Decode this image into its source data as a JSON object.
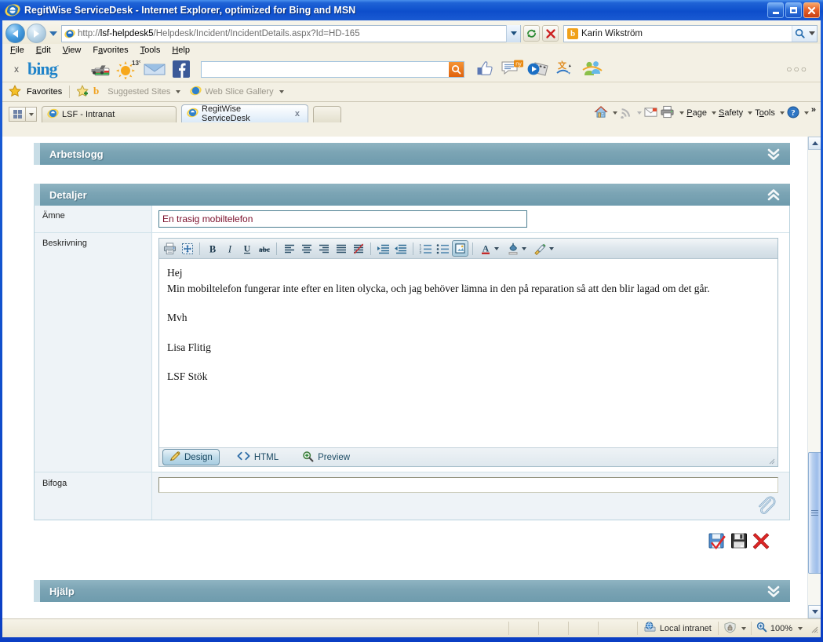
{
  "window": {
    "title": "RegitWise ServiceDesk - Internet Explorer, optimized for Bing and MSN",
    "minimize_label": "Minimize",
    "maximize_label": "Maximize",
    "close_label": "Close"
  },
  "address": {
    "back_label": "Back",
    "forward_label": "Forward",
    "recent_label": "Recent pages",
    "url_host": "lsf-helpdesk5",
    "url_prefix": "http://",
    "url_path": "/Helpdesk/Incident/IncidentDetails.aspx?Id=HD-165",
    "url_full": "http://lsf-helpdesk5/Helpdesk/Incident/IncidentDetails.aspx?Id=HD-165",
    "refresh_label": "Refresh",
    "stop_label": "Stop",
    "search_value": "Karin Wikström",
    "search_placeholder": "Search",
    "search_provider": "b"
  },
  "menu": {
    "items": [
      {
        "pre": "",
        "mnem": "F",
        "post": "ile"
      },
      {
        "pre": "",
        "mnem": "E",
        "post": "dit"
      },
      {
        "pre": "",
        "mnem": "V",
        "post": "iew"
      },
      {
        "pre": "F",
        "mnem": "a",
        "post": "vorites"
      },
      {
        "pre": "",
        "mnem": "T",
        "post": "ools"
      },
      {
        "pre": "",
        "mnem": "H",
        "post": "elp"
      }
    ]
  },
  "bingbar": {
    "close_label": "x",
    "logo": "bing",
    "logo_mark": "·",
    "weather_temp": "13°",
    "icons": [
      {
        "name": "car-deals-icon"
      },
      {
        "name": "weather-icon"
      },
      {
        "name": "mail-icon"
      },
      {
        "name": "facebook-icon"
      }
    ],
    "search_placeholder": "",
    "search_value": "",
    "right_icons": [
      {
        "name": "facebook-like-icon"
      },
      {
        "name": "messages-icon",
        "badge": "ny"
      },
      {
        "name": "video-icon"
      },
      {
        "name": "translate-icon"
      },
      {
        "name": "messenger-icon"
      }
    ],
    "overflow": "○○○"
  },
  "favbar": {
    "favorites_label": "Favorites",
    "add_label": "Add to Favorites",
    "suggested_sites": "Suggested Sites",
    "web_slice_gallery": "Web Slice Gallery"
  },
  "tabs": {
    "quicktabs_label": "Quick Tabs",
    "tablist_label": "Tab List",
    "items": [
      {
        "title": "LSF - Intranat",
        "active": false,
        "closable": false
      },
      {
        "title": "RegitWise ServiceDesk",
        "active": true,
        "closable": true,
        "close": "x"
      }
    ],
    "new_tab_label": "New Tab"
  },
  "commandbar": {
    "home_label": "Home",
    "feeds_label": "Feeds",
    "read_mail_label": "Read mail",
    "print_label": "Print",
    "page_label": "Page",
    "safety_label": "Safety",
    "tools_label": "Tools",
    "help_label": "Help",
    "overflow_label": "»"
  },
  "page": {
    "sections": [
      {
        "id": "arbetslogg",
        "title": "Arbetslogg",
        "expanded": false,
        "chevron": "chevron-double-down-icon"
      },
      {
        "id": "detaljer",
        "title": "Detaljer",
        "expanded": true,
        "chevron": "chevron-double-up-icon"
      },
      {
        "id": "hjalp",
        "title": "Hjälp",
        "expanded": false,
        "chevron": "chevron-double-down-icon"
      }
    ],
    "fields": {
      "subject": {
        "label": "Ämne",
        "value": "En trasig mobiltelefon",
        "placeholder": ""
      },
      "description": {
        "label": "Beskrivning",
        "body_lines": [
          "Hej",
          "Min mobiltelefon fungerar inte efter en liten olycka, och jag behöver lämna in den på reparation så att den blir lagad om det går.",
          "",
          "Mvh",
          "",
          "Lisa Flitig",
          "",
          "LSF Stök"
        ]
      },
      "attach": {
        "label": "Bifoga",
        "value": "",
        "placeholder": "",
        "browse_icon": "paperclip-icon"
      }
    },
    "editor_toolbar": {
      "groups": [
        [
          {
            "name": "print-icon",
            "label": "Print"
          },
          {
            "name": "select-all-icon",
            "label": "Select All"
          }
        ],
        [
          {
            "name": "bold-icon",
            "label": "B"
          },
          {
            "name": "italic-icon",
            "label": "I"
          },
          {
            "name": "underline-icon",
            "label": "U"
          },
          {
            "name": "strikethrough-icon",
            "label": "abc"
          }
        ],
        [
          {
            "name": "align-left-icon",
            "label": "Align Left"
          },
          {
            "name": "align-center-icon",
            "label": "Align Center"
          },
          {
            "name": "align-right-icon",
            "label": "Align Right"
          },
          {
            "name": "align-justify-icon",
            "label": "Justify"
          },
          {
            "name": "remove-format-icon",
            "label": "Remove Formatting"
          }
        ],
        [
          {
            "name": "indent-increase-icon",
            "label": "Increase Indent"
          },
          {
            "name": "indent-decrease-icon",
            "label": "Decrease Indent"
          }
        ],
        [
          {
            "name": "ordered-list-icon",
            "label": "Numbered List"
          },
          {
            "name": "unordered-list-icon",
            "label": "Bulleted List"
          },
          {
            "name": "insert-object-icon",
            "label": "Insert Object",
            "active": true
          }
        ],
        [
          {
            "name": "font-color-icon",
            "label": "A",
            "has_caret": true
          },
          {
            "name": "highlight-color-icon",
            "label": "Highlight",
            "has_caret": true
          },
          {
            "name": "format-painter-icon",
            "label": "Format Painter",
            "has_caret": true
          }
        ]
      ]
    },
    "editor_views": [
      {
        "label": "Design",
        "icon": "pencil-icon",
        "selected": true
      },
      {
        "label": "HTML",
        "icon": "code-brackets-icon",
        "selected": false
      },
      {
        "label": "Preview",
        "icon": "magnifier-plus-icon",
        "selected": false
      }
    ],
    "actions": [
      {
        "name": "save-and-close-button",
        "label": "Save and Close",
        "icon": "save-check-icon"
      },
      {
        "name": "save-button",
        "label": "Save",
        "icon": "floppy-disk-icon"
      },
      {
        "name": "cancel-button",
        "label": "Cancel",
        "icon": "red-x-icon"
      }
    ],
    "scrollbar": {
      "up_label": "Scroll up",
      "down_label": "Scroll down",
      "thumb_label": "Scroll thumb"
    }
  },
  "statusbar": {
    "zone": "Local intranet",
    "zone_icon": "globe-monitor-icon",
    "protected_icon": "protected-mode-icon",
    "zoom_icon": "magnifier-plus-icon",
    "zoom": "100%",
    "zoom_caret": "▾"
  },
  "colors": {
    "title_blue": "#0b3fc4",
    "section_header": "#7ba4b4",
    "section_header_accent": "#c8dde6",
    "page_bg": "#ffffff",
    "label_bg": "#eef3f7",
    "input_value": "#7b0f2b",
    "chrome_beige": "#f3f0e4"
  }
}
